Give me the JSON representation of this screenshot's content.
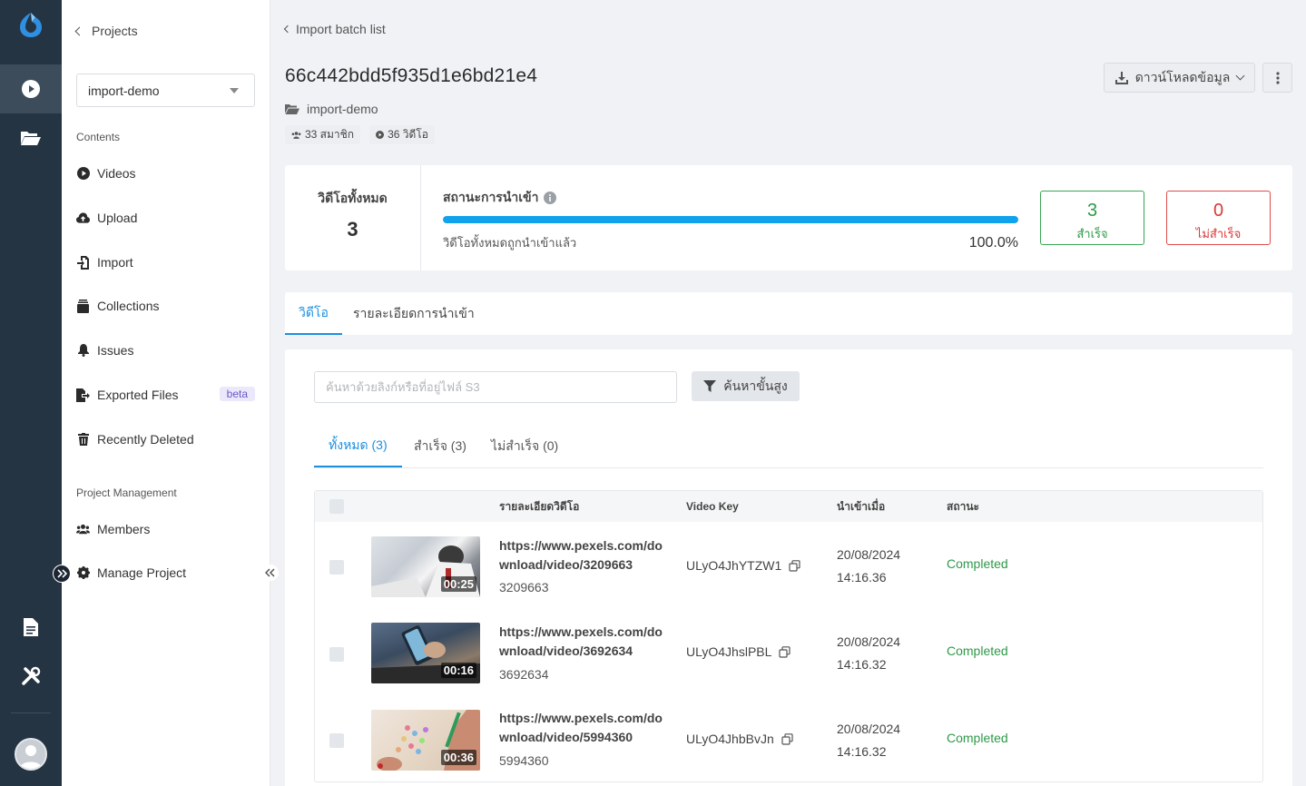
{
  "sidebar": {
    "back_label": "Projects",
    "project_select": "import-demo",
    "contents_heading": "Contents",
    "items": [
      {
        "label": "Videos",
        "icon": "play-circle-icon"
      },
      {
        "label": "Upload",
        "icon": "cloud-upload-icon"
      },
      {
        "label": "Import",
        "icon": "import-icon"
      },
      {
        "label": "Collections",
        "icon": "collections-icon"
      },
      {
        "label": "Issues",
        "icon": "bell-icon"
      },
      {
        "label": "Exported Files",
        "icon": "export-icon",
        "badge": "beta"
      },
      {
        "label": "Recently Deleted",
        "icon": "trash-icon"
      }
    ],
    "management_heading": "Project Management",
    "management_items": [
      {
        "label": "Members",
        "icon": "users-icon"
      },
      {
        "label": "Manage Project",
        "icon": "gear-icon"
      }
    ]
  },
  "header": {
    "breadcrumb": "Import batch list",
    "title": "66c442bdd5f935d1e6bd21e4",
    "project_name": "import-demo",
    "members_chip": "33 สมาชิก",
    "videos_chip": "36 วิดีโอ",
    "download_label": "ดาวน์โหลดข้อมูล"
  },
  "stats": {
    "total_label": "วิดีโอทั้งหมด",
    "total_value": "3",
    "progress_label": "สถานะการนำเข้า",
    "progress_fraction": 1.0,
    "progress_note": "วิดีโอทั้งหมดถูกนำเข้าแล้ว",
    "progress_percent": "100.0%",
    "success_count": "3",
    "success_label": "สำเร็จ",
    "fail_count": "0",
    "fail_label": "ไม่สำเร็จ",
    "success_color": "#2d9a48",
    "fail_color": "#d93838"
  },
  "tabs": [
    {
      "label": "วิดีโอ",
      "active": true
    },
    {
      "label": "รายละเอียดการนำเข้า",
      "active": false
    }
  ],
  "filter": {
    "search_placeholder": "ค้นหาด้วยลิงก์หรือที่อยู่ไฟล์ S3",
    "advanced_label": "ค้นหาขั้นสูง"
  },
  "subtabs": [
    {
      "label": "ทั้งหมด (3)",
      "active": true
    },
    {
      "label": "สำเร็จ (3)",
      "active": false
    },
    {
      "label": "ไม่สำเร็จ (0)",
      "active": false
    }
  ],
  "table": {
    "columns": [
      "รายละเอียดวิดีโอ",
      "Video Key",
      "นำเข้าเมื่อ",
      "สถานะ"
    ],
    "rows": [
      {
        "url": "https://www.pexels.com/download/video/3209663",
        "id": "3209663",
        "duration": "00:25",
        "key": "ULyO4JhYTZW1",
        "date": "20/08/2024",
        "time": "14:16.36",
        "status": "Completed"
      },
      {
        "url": "https://www.pexels.com/download/video/3692634",
        "id": "3692634",
        "duration": "00:16",
        "key": "ULyO4JhslPBL",
        "date": "20/08/2024",
        "time": "14:16.32",
        "status": "Completed"
      },
      {
        "url": "https://www.pexels.com/download/video/5994360",
        "id": "5994360",
        "duration": "00:36",
        "key": "ULyO4JhbBvJn",
        "date": "20/08/2024",
        "time": "14:16.32",
        "status": "Completed"
      }
    ]
  },
  "colors": {
    "rail_bg": "#253443",
    "accent": "#1d8fe0",
    "progress": "#10a3ec"
  }
}
